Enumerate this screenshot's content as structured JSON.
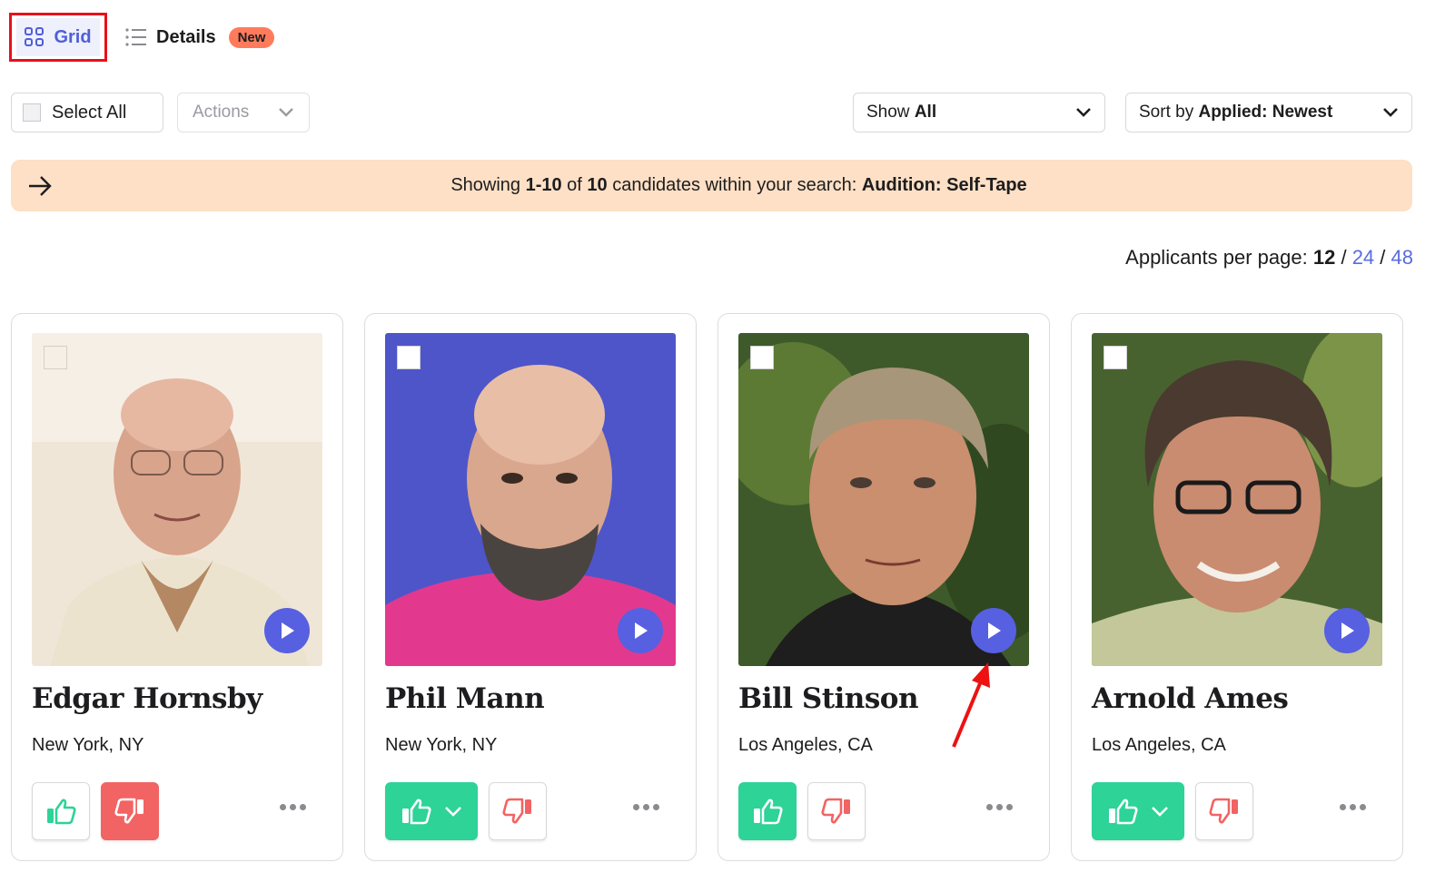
{
  "view_switch": {
    "grid_label": "Grid",
    "details_label": "Details",
    "new_badge": "New"
  },
  "toolbar": {
    "select_all_label": "Select All",
    "actions_label": "Actions",
    "filter_prefix": "Show ",
    "filter_value": "All",
    "sort_prefix": "Sort by ",
    "sort_value": "Applied: Newest"
  },
  "banner": {
    "prefix": "Showing ",
    "range": "1-10",
    "of_text": " of ",
    "total": "10",
    "middle": " candidates within your search: ",
    "search_term": "Audition: Self-Tape"
  },
  "per_page": {
    "label": "Applicants per page: ",
    "selected": "12",
    "separator": " / ",
    "option_2": "24",
    "option_3": "48"
  },
  "candidates": [
    {
      "name": "Edgar Hornsby",
      "location": "New York, NY"
    },
    {
      "name": "Phil Mann",
      "location": "New York, NY"
    },
    {
      "name": "Bill Stinson",
      "location": "Los Angeles, CA"
    },
    {
      "name": "Arnold Ames",
      "location": "Los Angeles, CA"
    }
  ],
  "colors": {
    "accent": "#5660e0",
    "highlight_box": "#e8101a",
    "banner_bg": "#fde0c5",
    "thumbs_up_green": "#2dd397",
    "thumbs_down_red": "#f26363",
    "new_badge": "#ff7b5c"
  },
  "icons": {
    "grid": "grid-icon",
    "details": "list-icon",
    "chevron": "chevron-down-icon",
    "arrow": "arrow-right-icon",
    "play": "play-icon",
    "thumbs_up": "thumbs-up-icon",
    "thumbs_down": "thumbs-down-icon",
    "more": "more-icon"
  }
}
